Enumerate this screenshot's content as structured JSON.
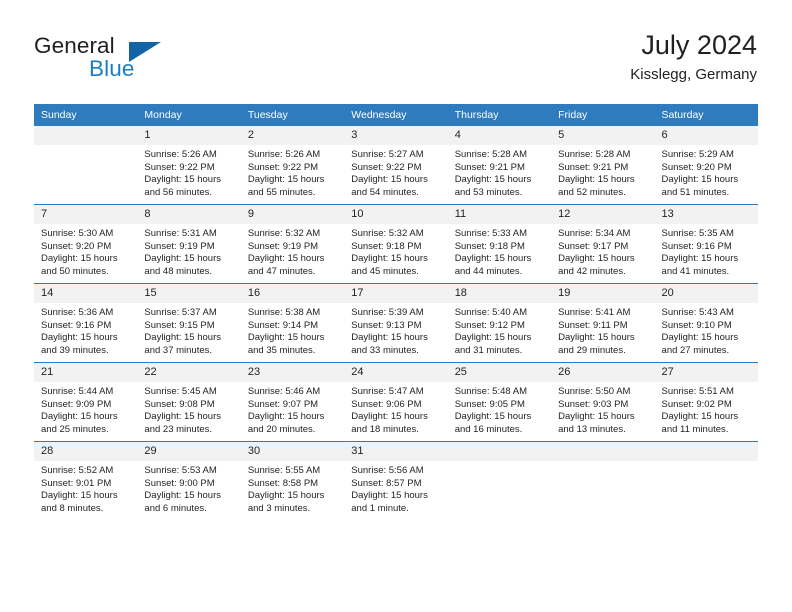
{
  "brand": {
    "name_part1": "General",
    "name_part2": "Blue",
    "flag_icon": "triangle-flag-icon",
    "accent_color": "#1b7ec2",
    "flag_color": "#1464a5"
  },
  "header": {
    "title": "July 2024",
    "location": "Kisslegg, Germany",
    "header_bg_color": "#2e7cbe",
    "daynum_bg_color": "#f2f2f2"
  },
  "weekday_headers": [
    "Sunday",
    "Monday",
    "Tuesday",
    "Wednesday",
    "Thursday",
    "Friday",
    "Saturday"
  ],
  "weeks": [
    [
      {
        "day": "",
        "lines": []
      },
      {
        "day": "1",
        "lines": [
          "Sunrise: 5:26 AM",
          "Sunset: 9:22 PM",
          "Daylight: 15 hours",
          "and 56 minutes."
        ]
      },
      {
        "day": "2",
        "lines": [
          "Sunrise: 5:26 AM",
          "Sunset: 9:22 PM",
          "Daylight: 15 hours",
          "and 55 minutes."
        ]
      },
      {
        "day": "3",
        "lines": [
          "Sunrise: 5:27 AM",
          "Sunset: 9:22 PM",
          "Daylight: 15 hours",
          "and 54 minutes."
        ]
      },
      {
        "day": "4",
        "lines": [
          "Sunrise: 5:28 AM",
          "Sunset: 9:21 PM",
          "Daylight: 15 hours",
          "and 53 minutes."
        ]
      },
      {
        "day": "5",
        "lines": [
          "Sunrise: 5:28 AM",
          "Sunset: 9:21 PM",
          "Daylight: 15 hours",
          "and 52 minutes."
        ]
      },
      {
        "day": "6",
        "lines": [
          "Sunrise: 5:29 AM",
          "Sunset: 9:20 PM",
          "Daylight: 15 hours",
          "and 51 minutes."
        ]
      }
    ],
    [
      {
        "day": "7",
        "lines": [
          "Sunrise: 5:30 AM",
          "Sunset: 9:20 PM",
          "Daylight: 15 hours",
          "and 50 minutes."
        ]
      },
      {
        "day": "8",
        "lines": [
          "Sunrise: 5:31 AM",
          "Sunset: 9:19 PM",
          "Daylight: 15 hours",
          "and 48 minutes."
        ]
      },
      {
        "day": "9",
        "lines": [
          "Sunrise: 5:32 AM",
          "Sunset: 9:19 PM",
          "Daylight: 15 hours",
          "and 47 minutes."
        ]
      },
      {
        "day": "10",
        "lines": [
          "Sunrise: 5:32 AM",
          "Sunset: 9:18 PM",
          "Daylight: 15 hours",
          "and 45 minutes."
        ]
      },
      {
        "day": "11",
        "lines": [
          "Sunrise: 5:33 AM",
          "Sunset: 9:18 PM",
          "Daylight: 15 hours",
          "and 44 minutes."
        ]
      },
      {
        "day": "12",
        "lines": [
          "Sunrise: 5:34 AM",
          "Sunset: 9:17 PM",
          "Daylight: 15 hours",
          "and 42 minutes."
        ]
      },
      {
        "day": "13",
        "lines": [
          "Sunrise: 5:35 AM",
          "Sunset: 9:16 PM",
          "Daylight: 15 hours",
          "and 41 minutes."
        ]
      }
    ],
    [
      {
        "day": "14",
        "lines": [
          "Sunrise: 5:36 AM",
          "Sunset: 9:16 PM",
          "Daylight: 15 hours",
          "and 39 minutes."
        ]
      },
      {
        "day": "15",
        "lines": [
          "Sunrise: 5:37 AM",
          "Sunset: 9:15 PM",
          "Daylight: 15 hours",
          "and 37 minutes."
        ]
      },
      {
        "day": "16",
        "lines": [
          "Sunrise: 5:38 AM",
          "Sunset: 9:14 PM",
          "Daylight: 15 hours",
          "and 35 minutes."
        ]
      },
      {
        "day": "17",
        "lines": [
          "Sunrise: 5:39 AM",
          "Sunset: 9:13 PM",
          "Daylight: 15 hours",
          "and 33 minutes."
        ]
      },
      {
        "day": "18",
        "lines": [
          "Sunrise: 5:40 AM",
          "Sunset: 9:12 PM",
          "Daylight: 15 hours",
          "and 31 minutes."
        ]
      },
      {
        "day": "19",
        "lines": [
          "Sunrise: 5:41 AM",
          "Sunset: 9:11 PM",
          "Daylight: 15 hours",
          "and 29 minutes."
        ]
      },
      {
        "day": "20",
        "lines": [
          "Sunrise: 5:43 AM",
          "Sunset: 9:10 PM",
          "Daylight: 15 hours",
          "and 27 minutes."
        ]
      }
    ],
    [
      {
        "day": "21",
        "lines": [
          "Sunrise: 5:44 AM",
          "Sunset: 9:09 PM",
          "Daylight: 15 hours",
          "and 25 minutes."
        ]
      },
      {
        "day": "22",
        "lines": [
          "Sunrise: 5:45 AM",
          "Sunset: 9:08 PM",
          "Daylight: 15 hours",
          "and 23 minutes."
        ]
      },
      {
        "day": "23",
        "lines": [
          "Sunrise: 5:46 AM",
          "Sunset: 9:07 PM",
          "Daylight: 15 hours",
          "and 20 minutes."
        ]
      },
      {
        "day": "24",
        "lines": [
          "Sunrise: 5:47 AM",
          "Sunset: 9:06 PM",
          "Daylight: 15 hours",
          "and 18 minutes."
        ]
      },
      {
        "day": "25",
        "lines": [
          "Sunrise: 5:48 AM",
          "Sunset: 9:05 PM",
          "Daylight: 15 hours",
          "and 16 minutes."
        ]
      },
      {
        "day": "26",
        "lines": [
          "Sunrise: 5:50 AM",
          "Sunset: 9:03 PM",
          "Daylight: 15 hours",
          "and 13 minutes."
        ]
      },
      {
        "day": "27",
        "lines": [
          "Sunrise: 5:51 AM",
          "Sunset: 9:02 PM",
          "Daylight: 15 hours",
          "and 11 minutes."
        ]
      }
    ],
    [
      {
        "day": "28",
        "lines": [
          "Sunrise: 5:52 AM",
          "Sunset: 9:01 PM",
          "Daylight: 15 hours",
          "and 8 minutes."
        ]
      },
      {
        "day": "29",
        "lines": [
          "Sunrise: 5:53 AM",
          "Sunset: 9:00 PM",
          "Daylight: 15 hours",
          "and 6 minutes."
        ]
      },
      {
        "day": "30",
        "lines": [
          "Sunrise: 5:55 AM",
          "Sunset: 8:58 PM",
          "Daylight: 15 hours",
          "and 3 minutes."
        ]
      },
      {
        "day": "31",
        "lines": [
          "Sunrise: 5:56 AM",
          "Sunset: 8:57 PM",
          "Daylight: 15 hours",
          "and 1 minute."
        ]
      },
      {
        "day": "",
        "lines": []
      },
      {
        "day": "",
        "lines": []
      },
      {
        "day": "",
        "lines": []
      }
    ]
  ]
}
